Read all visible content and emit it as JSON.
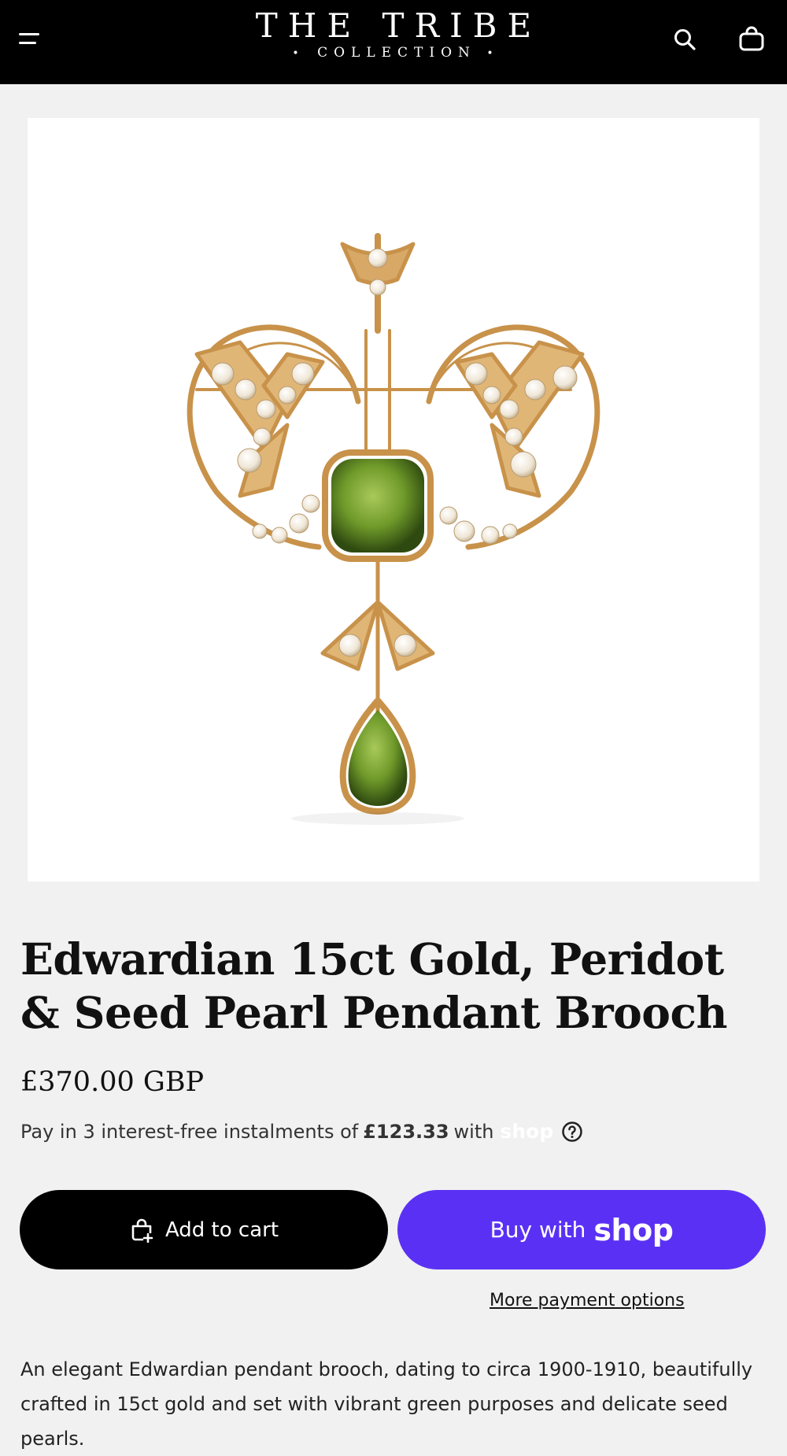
{
  "header": {
    "logo_main": "THE TRIBE",
    "logo_sub": "COLLECTION",
    "logo_dot": "•",
    "menu_icon": "hamburger-icon",
    "search_icon": "search-icon",
    "cart_icon": "shopping-bag-icon",
    "background": "#000000"
  },
  "product": {
    "image_alt": "Edwardian gold brooch with peridot and seed pearls",
    "title": "Edwardian 15ct Gold, Peridot & Seed Pearl Pendant Brooch",
    "price": "£370.00 GBP",
    "installments": {
      "prefix": "Pay in 3 interest-free instalments of",
      "amount": "£123.33",
      "suffix": "with",
      "brand": "shop"
    },
    "add_to_cart_label": "Add to cart",
    "buy_with_label": "Buy with",
    "buy_with_brand": "shop",
    "more_payment_label": "More payment options",
    "description": "An elegant Edwardian pendant brooch, dating to circa 1900-1910, beautifully crafted in 15ct gold and set with vibrant green purposes and delicate seed pearls."
  },
  "colors": {
    "page_bg": "#f1f1f1",
    "shop_purple": "#5a31f4",
    "gold": "#c8924a",
    "peridot": "#6f9a2a"
  }
}
